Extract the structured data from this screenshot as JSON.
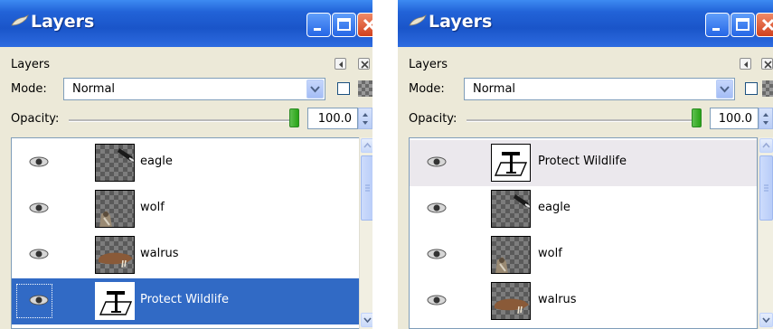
{
  "windows": [
    {
      "title": "Layers",
      "panel_title": "Layers",
      "mode_label": "Mode:",
      "mode_value": "Normal",
      "opacity_label": "Opacity:",
      "opacity_value": "100.0",
      "layers": [
        {
          "name": "eagle",
          "thumbnail": "eagle",
          "visible": true,
          "selected": false
        },
        {
          "name": "wolf",
          "thumbnail": "wolf",
          "visible": true,
          "selected": false
        },
        {
          "name": "walrus",
          "thumbnail": "walrus",
          "visible": true,
          "selected": false
        },
        {
          "name": "Protect Wildlife",
          "thumbnail": "text-layer",
          "visible": true,
          "selected": true
        }
      ]
    },
    {
      "title": "Layers",
      "panel_title": "Layers",
      "mode_label": "Mode:",
      "mode_value": "Normal",
      "opacity_label": "Opacity:",
      "opacity_value": "100.0",
      "layers": [
        {
          "name": "Protect Wildlife",
          "thumbnail": "text-layer",
          "visible": true,
          "selected": false,
          "highlighted": true
        },
        {
          "name": "eagle",
          "thumbnail": "eagle",
          "visible": true,
          "selected": false
        },
        {
          "name": "wolf",
          "thumbnail": "wolf",
          "visible": true,
          "selected": false
        },
        {
          "name": "walrus",
          "thumbnail": "walrus",
          "visible": true,
          "selected": false
        }
      ]
    }
  ],
  "colors": {
    "titlebar": "#2263d8",
    "selection": "#316ac5",
    "close_button": "#d1411e",
    "opacity_thumb": "#28a316"
  },
  "icons": [
    "gimp-app-icon",
    "minimize-icon",
    "maximize-icon",
    "close-icon",
    "tab-menu-icon",
    "close-dock-icon",
    "eye-icon",
    "checkerboard-icon"
  ]
}
